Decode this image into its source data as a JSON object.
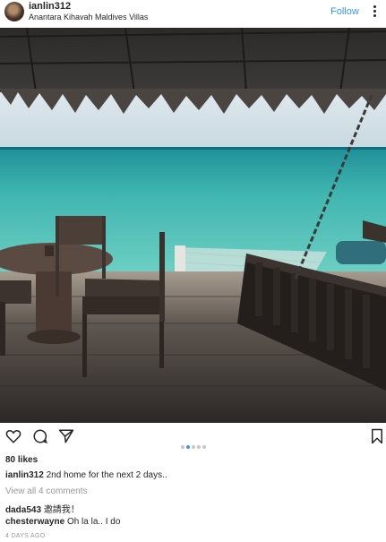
{
  "header": {
    "username": "ianlin312",
    "location": "Anantara Kihavah Maldives Villas",
    "follow_label": "Follow"
  },
  "carousel": {
    "count": 5,
    "active_index": 1
  },
  "likes_text": "80 likes",
  "caption": {
    "user": "ianlin312",
    "text": "2nd home for the next 2 days.."
  },
  "view_all_comments": "View all 4 comments",
  "comments": [
    {
      "user": "dada543",
      "text": "邀請我！"
    },
    {
      "user": "chesterwayne",
      "text": "Oh la la.. I do"
    }
  ],
  "timestamp": "4 DAYS AGO",
  "colors": {
    "accent": "#3897f0",
    "secondary_text": "#999999"
  }
}
